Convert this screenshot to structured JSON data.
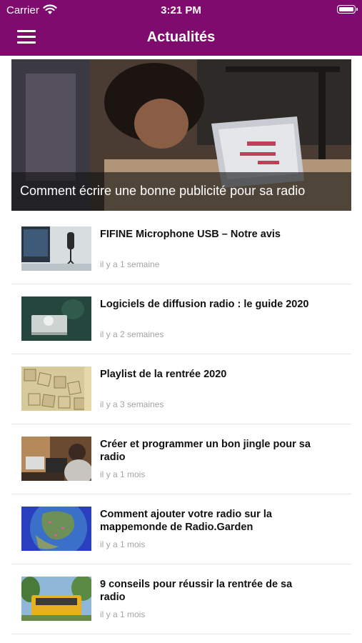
{
  "status_bar": {
    "carrier": "Carrier",
    "time": "3:21 PM"
  },
  "header": {
    "title": "Actualités",
    "menu_icon": "hamburger-menu-icon",
    "background": "#800b6e"
  },
  "featured": {
    "title": "Comment écrire une bonne publicité pour sa radio"
  },
  "articles": [
    {
      "title": "FIFINE Microphone USB – Notre avis",
      "time": "il y a 1 semaine"
    },
    {
      "title": "Logiciels de diffusion radio : le guide 2020",
      "time": "il y a 2 semaines"
    },
    {
      "title": "Playlist de la rentrée 2020",
      "time": "il y a 3 semaines"
    },
    {
      "title": "Créer et programmer un bon jingle pour sa radio",
      "time": "il y a 1 mois"
    },
    {
      "title": "Comment ajouter votre radio sur la mappemonde de Radio.Garden",
      "time": "il y a 1 mois"
    },
    {
      "title": "9 conseils pour réussir la rentrée de sa radio",
      "time": "il y a 1 mois"
    }
  ]
}
